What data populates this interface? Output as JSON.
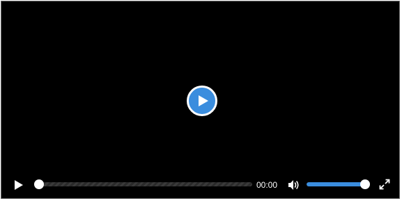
{
  "player": {
    "big_play_icon": "play-circle-icon",
    "controls": {
      "play_icon": "play-icon",
      "current_time": "00:00",
      "progress_fraction": 0.0,
      "volume_icon": "volume-high-icon",
      "volume_fraction": 1.0,
      "fullscreen_icon": "fullscreen-icon"
    },
    "colors": {
      "accent": "#3a8dde",
      "background": "#000000",
      "foreground": "#ffffff"
    }
  }
}
